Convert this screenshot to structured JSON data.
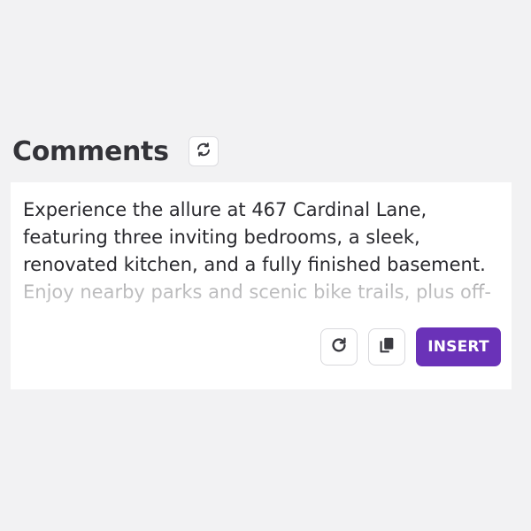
{
  "header": {
    "title": "Comments",
    "refresh_icon": "refresh-arrows-icon"
  },
  "card": {
    "text": "Experience the allure at 467 Cardinal Lane, featuring three inviting bedrooms, a sleek, renovated kitchen, and a fully finished basement. Enjoy nearby parks and scenic bike trails, plus off-street parking. Step into your",
    "actions": {
      "redo_icon": "redo-icon",
      "copy_icon": "copy-icon",
      "insert_label": "INSERT"
    }
  },
  "colors": {
    "background": "#f2f2f3",
    "card": "#ffffff",
    "accent": "#6a32b8",
    "text": "#2a2a2f"
  }
}
